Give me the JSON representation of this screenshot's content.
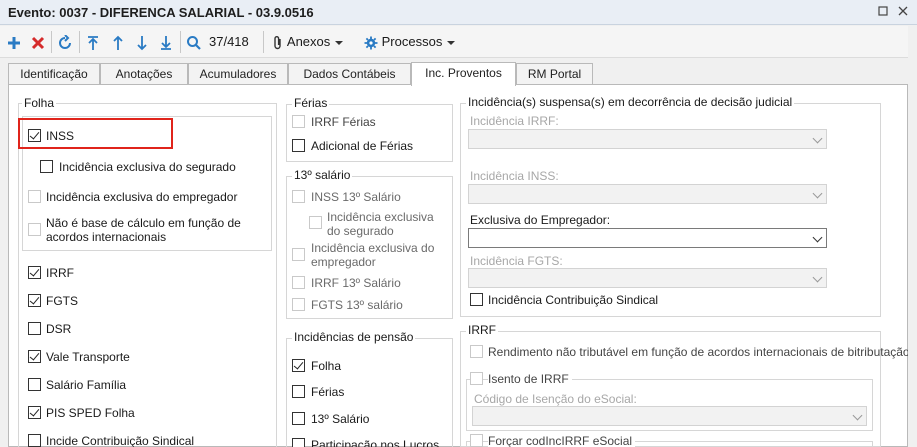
{
  "window": {
    "title": "Evento: 0037 - DIFERENCA SALARIAL - 03.9.0516",
    "min_icon": "restore-icon",
    "close_icon": "close-icon"
  },
  "toolbar": {
    "record_counter": "37/418",
    "anexos_label": "Anexos",
    "processos_label": "Processos"
  },
  "tabs": [
    {
      "label": "Identificação"
    },
    {
      "label": "Anotações"
    },
    {
      "label": "Acumuladores"
    },
    {
      "label": "Dados Contábeis"
    },
    {
      "label": "Inc. Proventos"
    },
    {
      "label": "RM Portal"
    }
  ],
  "folha": {
    "title": "Folha",
    "inss": "INSS",
    "inc_exclusiva_segurado": "Incidência exclusiva do segurado",
    "inc_exclusiva_empregador": "Incidência exclusiva do empregador",
    "nao_base_calculo": "Não é base de cálculo em função de acordos internacionais",
    "irrf": "IRRF",
    "fgts": "FGTS",
    "dsr": "DSR",
    "vale_transporte": "Vale Transporte",
    "salario_familia": "Salário Família",
    "pis_sped": "PIS SPED Folha",
    "incide_contrib_sindical": "Incide Contribuição Sindical"
  },
  "ferias": {
    "title": "Férias",
    "irrf_ferias": "IRRF Férias",
    "adicional_ferias": "Adicional de Férias"
  },
  "decimo": {
    "title": "13º salário",
    "inss_13": "INSS 13º Salário",
    "inc_exclusiva_segurado": "Incidência exclusiva do segurado",
    "inc_exclusiva_empregador": "Incidência exclusiva do empregador",
    "irrf_13": "IRRF 13º Salário",
    "fgts_13": "FGTS 13º salário"
  },
  "pensao": {
    "title": "Incidências de pensão",
    "folha": "Folha",
    "ferias": "Férias",
    "decimo": "13º Salário",
    "plr": "Participação nos Lucros"
  },
  "judicial": {
    "title": "Incidência(s) suspensa(s) em decorrência de decisão judicial",
    "inc_irrf": "Incidência IRRF:",
    "inc_inss": "Incidência INSS:",
    "exclusiva_empregador": "Exclusiva do Empregador:",
    "inc_fgts": "Incidência FGTS:",
    "inc_contrib_sindical": "Incidência Contribuição Sindical"
  },
  "irrf": {
    "title": "IRRF",
    "rendimento_nao_tributavel": "Rendimento não tributável em função de acordos internacionais de bitributação",
    "isento": "Isento de IRRF",
    "codigo_isencao": "Código de Isenção do eSocial:",
    "forcar_cod": "Forçar codIncIRRF eSocial"
  }
}
